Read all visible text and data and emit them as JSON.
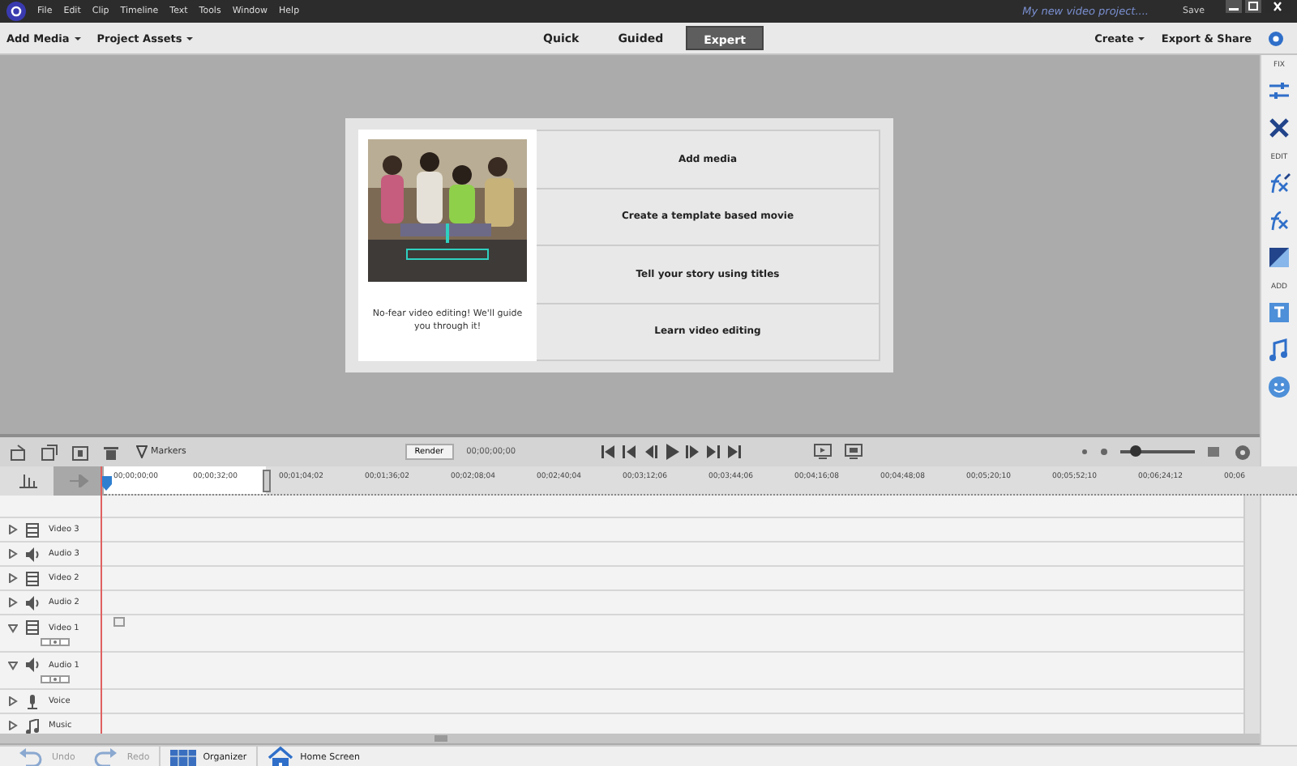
{
  "menu": [
    "File",
    "Edit",
    "Clip",
    "Timeline",
    "Text",
    "Tools",
    "Window",
    "Help"
  ],
  "project_title": "My new video project....",
  "save": "Save",
  "toolbar": {
    "left": [
      "Add Media",
      "Project Assets"
    ],
    "modes": [
      {
        "label": "Quick",
        "selected": false
      },
      {
        "label": "Guided",
        "selected": false
      },
      {
        "label": "Expert",
        "selected": true
      }
    ],
    "right": [
      "Create",
      "Export & Share"
    ]
  },
  "guide": {
    "caption": "No-fear video editing! We'll guide you through it!",
    "options": [
      "Add media",
      "Create a template based movie",
      "Tell your story using titles",
      "Learn video editing"
    ]
  },
  "panel_sections": [
    {
      "label": "FIX"
    },
    {
      "label": "EDIT"
    },
    {
      "label": "ADD"
    }
  ],
  "timeline": {
    "markers": "Markers",
    "render": "Render",
    "timecode": "00;00;00;00",
    "zoom": {
      "level": 0.2
    },
    "ruler": [
      "00;00;00;00",
      "00;00;32;00",
      "00;01;04;02",
      "00;01;36;02",
      "00;02;08;04",
      "00;02;40;04",
      "00;03;12;06",
      "00;03;44;06",
      "00;04;16;08",
      "00;04;48;08",
      "00;05;20;10",
      "00;05;52;10",
      "00;06;24;12",
      "00;06"
    ],
    "tracks": [
      {
        "name": "Video 3",
        "kind": "video",
        "expanded": false
      },
      {
        "name": "Audio 3",
        "kind": "audio",
        "expanded": false
      },
      {
        "name": "Video 2",
        "kind": "video",
        "expanded": false
      },
      {
        "name": "Audio 2",
        "kind": "audio",
        "expanded": false
      },
      {
        "name": "Video 1",
        "kind": "video",
        "expanded": true
      },
      {
        "name": "Audio 1",
        "kind": "audio",
        "expanded": true
      },
      {
        "name": "Voice",
        "kind": "voice",
        "expanded": false
      },
      {
        "name": "Music",
        "kind": "music",
        "expanded": false
      }
    ]
  },
  "bottom": [
    {
      "label": "Undo",
      "disabled": true
    },
    {
      "label": "Redo",
      "disabled": true
    },
    {
      "label": "Organizer",
      "disabled": false
    },
    {
      "label": "Home Screen",
      "disabled": false
    }
  ]
}
